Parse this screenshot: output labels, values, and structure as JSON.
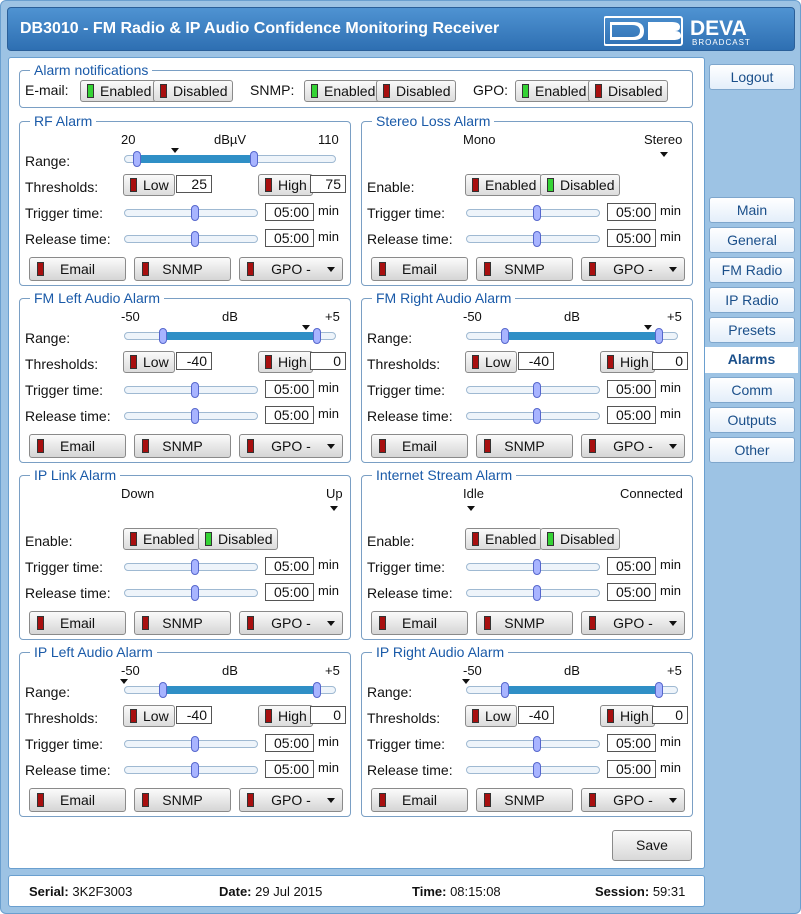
{
  "header": {
    "title": "DB3010 - FM Radio & IP Audio Confidence Monitoring Receiver",
    "logo_text": "DEVA",
    "logo_sub": "BROADCAST"
  },
  "sidebar": {
    "logout": "Logout",
    "items": [
      "Main",
      "General",
      "FM Radio",
      "IP Radio",
      "Presets",
      "Alarms",
      "Comm",
      "Outputs",
      "Other"
    ],
    "active": "Alarms"
  },
  "notifications": {
    "legend": "Alarm notifications",
    "email_label": "E-mail:",
    "snmp_label": "SNMP:",
    "gpo_label": "GPO:",
    "enabled": "Enabled",
    "disabled": "Disabled"
  },
  "labels": {
    "range": "Range:",
    "thresholds": "Thresholds:",
    "trigger": "Trigger time:",
    "release": "Release time:",
    "enable": "Enable:",
    "min": "min",
    "low": "Low",
    "high": "High",
    "enabled": "Enabled",
    "disabled": "Disabled",
    "email": "Email",
    "snmp": "SNMP",
    "gpo": "GPO -"
  },
  "rf": {
    "legend": "RF Alarm",
    "min": "20",
    "unit": "dBµV",
    "max": "110",
    "low": "25",
    "high": "75",
    "trigger": "05:00",
    "release": "05:00"
  },
  "stereo": {
    "legend": "Stereo Loss Alarm",
    "left": "Mono",
    "right": "Stereo",
    "trigger": "05:00",
    "release": "05:00"
  },
  "fmleft": {
    "legend": "FM Left Audio Alarm",
    "min": "-50",
    "unit": "dB",
    "max": "+5",
    "low": "-40",
    "high": "0",
    "trigger": "05:00",
    "release": "05:00"
  },
  "fmright": {
    "legend": "FM Right Audio Alarm",
    "min": "-50",
    "unit": "dB",
    "max": "+5",
    "low": "-40",
    "high": "0",
    "trigger": "05:00",
    "release": "05:00"
  },
  "iplink": {
    "legend": "IP Link Alarm",
    "left": "Down",
    "right": "Up",
    "trigger": "05:00",
    "release": "05:00"
  },
  "stream": {
    "legend": "Internet Stream Alarm",
    "left": "Idle",
    "right": "Connected",
    "trigger": "05:00",
    "release": "05:00"
  },
  "ipleft": {
    "legend": "IP Left Audio Alarm",
    "min": "-50",
    "unit": "dB",
    "max": "+5",
    "low": "-40",
    "high": "0",
    "trigger": "05:00",
    "release": "05:00"
  },
  "ipright": {
    "legend": "IP Right Audio Alarm",
    "min": "-50",
    "unit": "dB",
    "max": "+5",
    "low": "-40",
    "high": "0",
    "trigger": "05:00",
    "release": "05:00"
  },
  "save": "Save",
  "footer": {
    "serial_label": "Serial:",
    "serial": "3K2F3003",
    "date_label": "Date:",
    "date": "29 Jul 2015",
    "time_label": "Time:",
    "time": "08:15:08",
    "session_label": "Session:",
    "session": "59:31"
  },
  "colors": {
    "accent": "#1a5aa8",
    "led_on": "#35d335",
    "led_off": "#a80f0f",
    "slider_fill": "#2f8fc6"
  }
}
